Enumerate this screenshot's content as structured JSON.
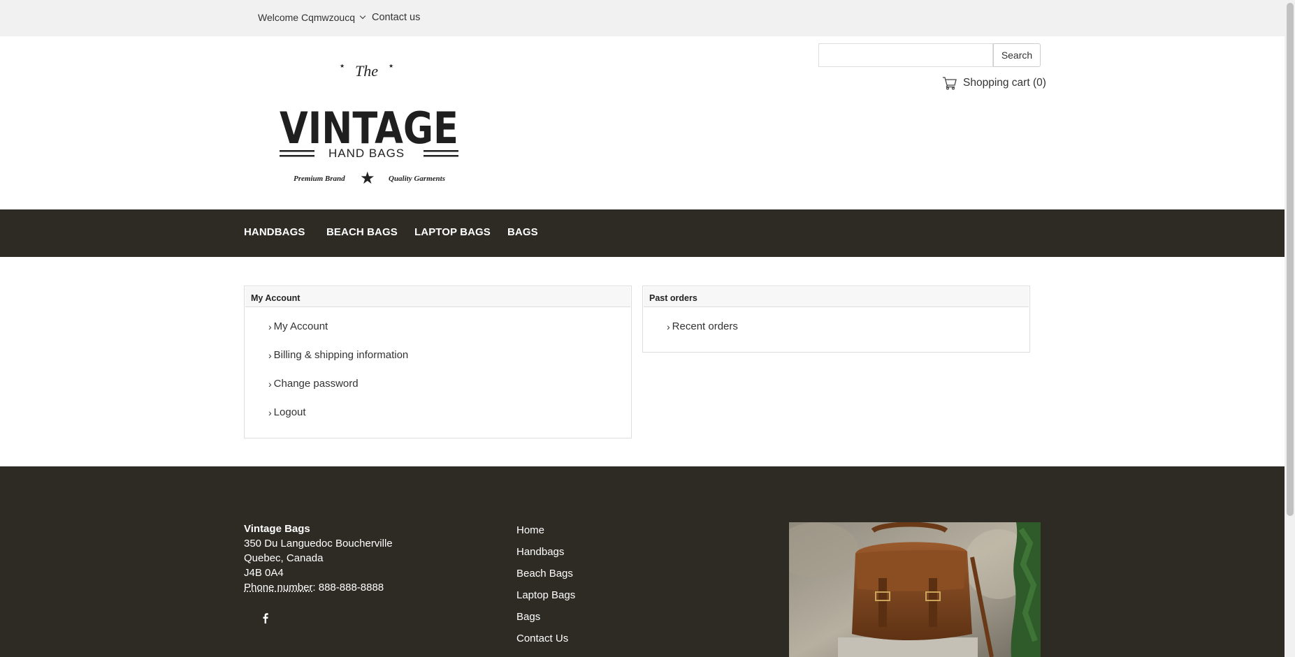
{
  "topbar": {
    "welcome": "Welcome Cqmwzoucq",
    "contact": "Contact us"
  },
  "header": {
    "logo": {
      "the": "The",
      "brand": "VINTAGE",
      "sub": "HAND BAGS",
      "tag_left": "Premium Brand",
      "tag_right": "Quality Garments"
    },
    "search": {
      "placeholder": "",
      "button": "Search"
    },
    "cart": "Shopping cart (0)"
  },
  "nav": {
    "items": [
      "HANDBAGS",
      "BEACH BAGS",
      "LAPTOP BAGS",
      "BAGS"
    ]
  },
  "account_panel": {
    "title": "My Account",
    "links": [
      "My Account",
      "Billing & shipping information",
      "Change password",
      "Logout"
    ]
  },
  "orders_panel": {
    "title": "Past orders",
    "links": [
      "Recent orders"
    ]
  },
  "footer": {
    "company": "Vintage Bags",
    "address1": "350 Du Languedoc Boucherville",
    "address2": "Quebec, Canada",
    "postal": "J4B 0A4",
    "phone_label": "Phone number",
    "phone": ": 888-888-8888",
    "social_icon": "facebook-icon",
    "links": [
      "Home",
      "Handbags",
      "Beach Bags",
      "Laptop Bags",
      "Bags",
      "Contact Us"
    ]
  },
  "colors": {
    "nav_bg": "#2d2b24",
    "topbar_bg": "#f1f1f1",
    "leather": "#7a4420"
  }
}
